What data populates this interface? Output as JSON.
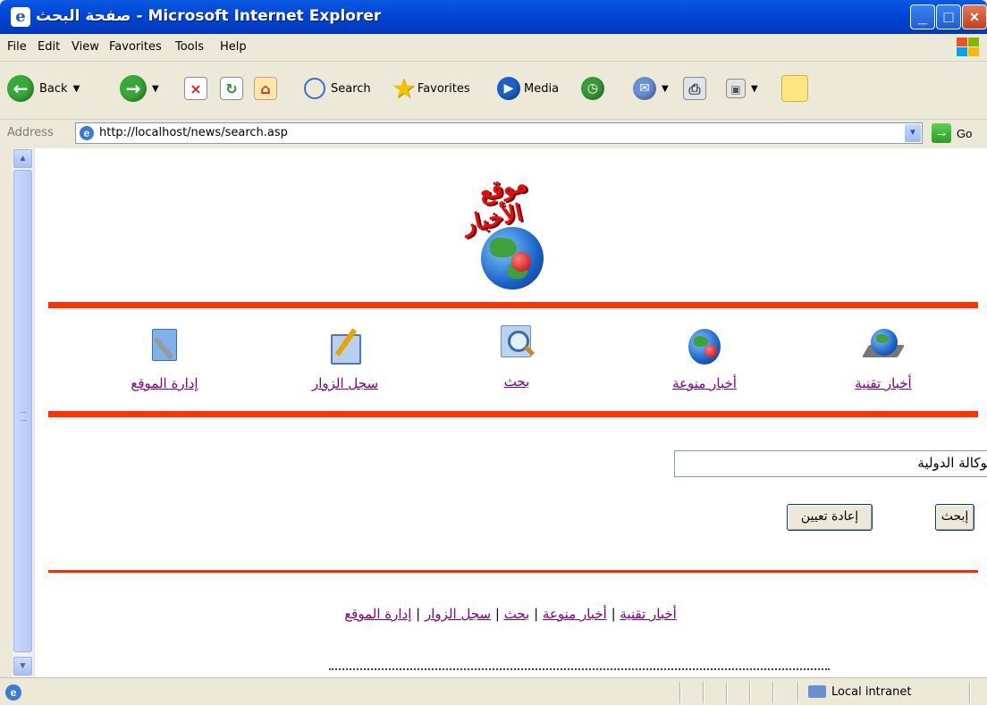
{
  "window": {
    "title": "صفحة البحث - Microsoft Internet Explorer",
    "controls": {
      "minimize": "_",
      "maximize": "□",
      "close": "×"
    }
  },
  "menu": [
    "File",
    "Edit",
    "View",
    "Favorites",
    "Tools",
    "Help"
  ],
  "toolbar": {
    "back_label": "Back",
    "search_label": "Search",
    "favorites_label": "Favorites",
    "media_label": "Media"
  },
  "address": {
    "label": "Address",
    "url": "http://localhost/news/search.asp",
    "go_label": "Go"
  },
  "site": {
    "logo_line1": "موقع",
    "logo_line2": "الأخبار",
    "nav": [
      {
        "label": "أخبار تقنية"
      },
      {
        "label": "أخبار منوعة"
      },
      {
        "label": "بحث"
      },
      {
        "label": "سجل الزوار"
      },
      {
        "label": "إدارة الموقع"
      }
    ],
    "search_value": "الوكالة الدولية",
    "submit_label": "إبحث",
    "reset_label": "إعادة تعيين",
    "footer": {
      "links": [
        "أخبار تقنية",
        "أخبار منوعة",
        "بحث",
        "سجل الزوار",
        "إدارة الموقع"
      ],
      "separator": "|"
    }
  },
  "status": {
    "zone": "Local intranet"
  },
  "colors": {
    "accent_red": "#ff3300",
    "link_visited": "#800080",
    "xp_title_blue": "#0045d8"
  }
}
